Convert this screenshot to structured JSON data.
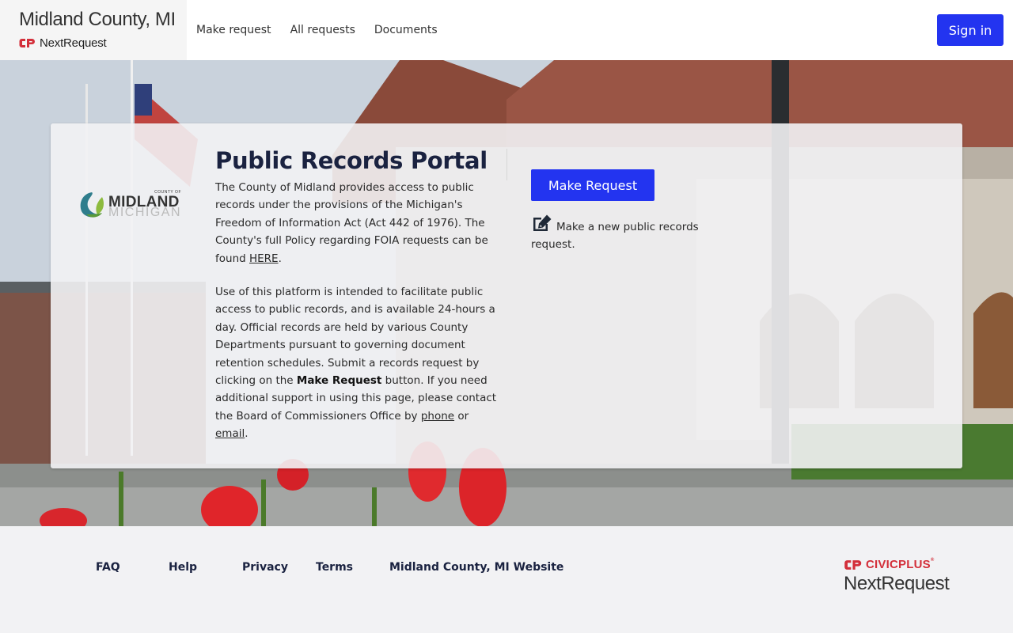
{
  "header": {
    "site_title": "Midland County, MI",
    "brand_name": "NextRequest",
    "nav": [
      {
        "label": "Make request"
      },
      {
        "label": "All requests"
      },
      {
        "label": "Documents"
      }
    ],
    "sign_in_label": "Sign in"
  },
  "card": {
    "logo": {
      "small": "COUNTY OF",
      "main": "MIDLAND",
      "sub": "MICHIGAN"
    },
    "title": "Public Records Portal",
    "para1_before": "The County of Midland provides access to public records under the provisions of the Michigan's Freedom of Information Act (Act 442 of 1976). The County's full Policy regarding FOIA requests can be found ",
    "para1_link": "HERE",
    "para1_after": ".",
    "para2_before": "Use of this platform is intended to facilitate public access to public records, and is available 24-hours a day. Official records are held by various County Departments pursuant to governing document retention schedules. Submit a records request by clicking on the ",
    "para2_bold": "Make Request",
    "para2_mid": " button. If you need additional support in using this page, please contact the Board of Commissioners Office by ",
    "para2_link_phone": "phone",
    "para2_or": " or ",
    "para2_link_email": "email",
    "para2_end": ".",
    "make_request_label": "Make Request",
    "action_description": "Make a new public records request."
  },
  "footer": {
    "links": [
      {
        "label": "FAQ"
      },
      {
        "label": "Help"
      },
      {
        "label": "Privacy"
      },
      {
        "label": "Terms"
      },
      {
        "label": "Midland County, MI Website"
      }
    ],
    "civic_brand": "CIVICPLUS",
    "civic_mark": "®",
    "product": "NextRequest"
  },
  "colors": {
    "primary": "#2334f0",
    "title": "#1a2240",
    "brand_red": "#d32f3a"
  },
  "icons": {
    "brand_logo": "np-logo-icon",
    "action": "edit-icon"
  }
}
